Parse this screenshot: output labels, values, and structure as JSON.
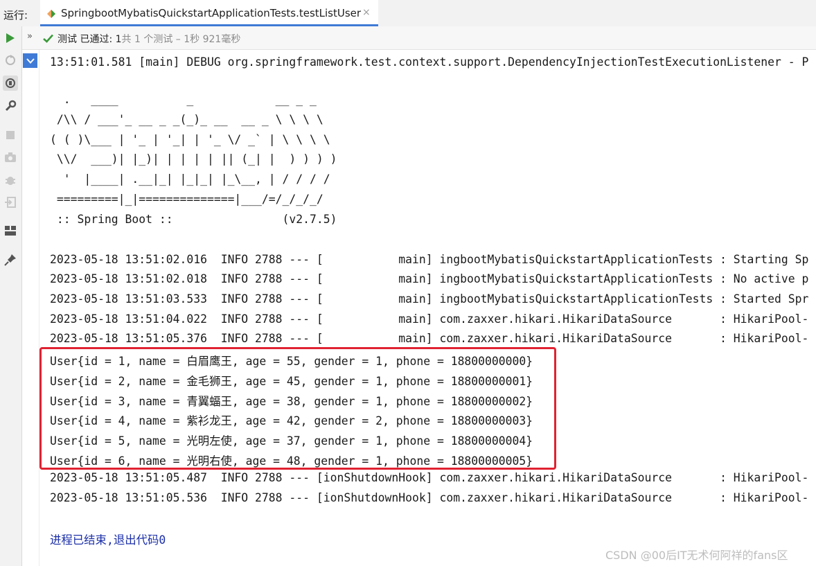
{
  "run_window": {
    "label": "运行:",
    "tab_title": "SpringbootMybatisQuickstartApplicationTests.testListUser",
    "close_glyph": "×"
  },
  "status": {
    "chevron": "»",
    "passed_label": "测试 已通过: ",
    "passed_count": "1",
    "total": "共 1 个测试",
    "sep": " – ",
    "duration": "1秒 921毫秒"
  },
  "sidebar_icons": [
    "run-icon",
    "rerun-failed-icon",
    "toggle-auto-test-icon",
    "settings-wrench-icon",
    "stop-icon",
    "camera-icon",
    "debug-icon",
    "import-icon",
    "layout-icon",
    "pin-icon"
  ],
  "console": {
    "lines": [
      "13:51:01.581 [main] DEBUG org.springframework.test.context.support.DependencyInjectionTestExecutionListener - P",
      "",
      "  .   ____          _            __ _ _",
      " /\\\\ / ___'_ __ _ _(_)_ __  __ _ \\ \\ \\ \\",
      "( ( )\\___ | '_ | '_| | '_ \\/ _` | \\ \\ \\ \\",
      " \\\\/  ___)| |_)| | | | | || (_| |  ) ) ) )",
      "  '  |____| .__|_| |_|_| |_\\__, | / / / /",
      " =========|_|==============|___/=/_/_/_/",
      " :: Spring Boot ::                (v2.7.5)",
      "",
      "2023-05-18 13:51:02.016  INFO 2788 --- [           main] ingbootMybatisQuickstartApplicationTests : Starting Sp",
      "2023-05-18 13:51:02.018  INFO 2788 --- [           main] ingbootMybatisQuickstartApplicationTests : No active p",
      "2023-05-18 13:51:03.533  INFO 2788 --- [           main] ingbootMybatisQuickstartApplicationTests : Started Spr",
      "2023-05-18 13:51:04.022  INFO 2788 --- [           main] com.zaxxer.hikari.HikariDataSource       : HikariPool-",
      "2023-05-18 13:51:05.376  INFO 2788 --- [           main] com.zaxxer.hikari.HikariDataSource       : HikariPool-",
      "User{id = 1, name = 白眉鹰王, age = 55, gender = 1, phone = 18800000000}",
      "User{id = 2, name = 金毛狮王, age = 45, gender = 1, phone = 18800000001}",
      "User{id = 3, name = 青翼蝠王, age = 38, gender = 1, phone = 18800000002}",
      "User{id = 4, name = 紫衫龙王, age = 42, gender = 2, phone = 18800000003}",
      "User{id = 5, name = 光明左使, age = 37, gender = 1, phone = 18800000004}",
      "User{id = 6, name = 光明右使, age = 48, gender = 1, phone = 18800000005}",
      "2023-05-18 13:51:05.487  INFO 2788 --- [ionShutdownHook] com.zaxxer.hikari.HikariDataSource       : HikariPool-",
      "2023-05-18 13:51:05.536  INFO 2788 --- [ionShutdownHook] com.zaxxer.hikari.HikariDataSource       : HikariPool-",
      "",
      "进程已结束,退出代码0"
    ]
  },
  "watermark": "CSDN @00后IT无术何阿祥的fans区",
  "colors": {
    "accent": "#3f7ad6",
    "highlight": "#e02231",
    "passed": "#3a9a3a",
    "exit_text": "#1b2fa8"
  }
}
